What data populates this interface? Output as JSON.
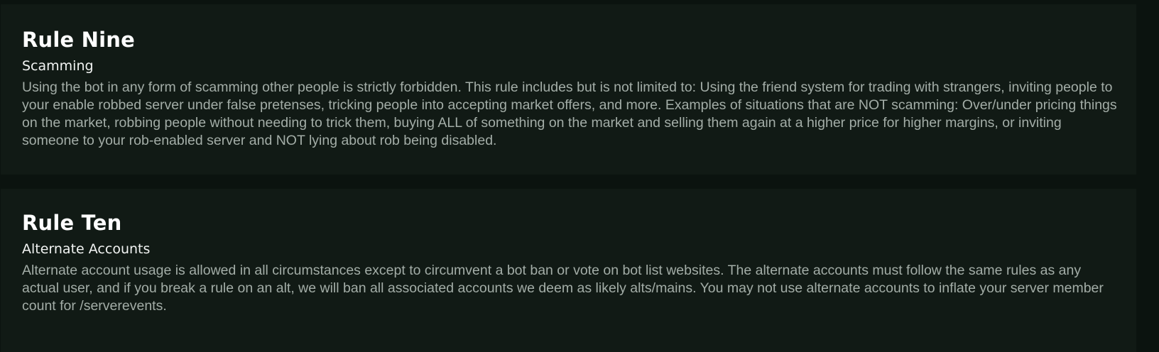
{
  "rules": [
    {
      "title": "Rule Nine",
      "subtitle": "Scamming",
      "body": "Using the bot in any form of scamming other people is strictly forbidden. This rule includes but is not limited to: Using the friend system for trading with strangers, inviting people to your enable robbed server under false pretenses, tricking people into accepting market offers, and more. Examples of situations that are NOT scamming: Over/under pricing things on the market, robbing people without needing to trick them, buying ALL of something on the market and selling them again at a higher price for higher margins, or inviting someone to your rob-enabled server and NOT lying about rob being disabled."
    },
    {
      "title": "Rule Ten",
      "subtitle": "Alternate Accounts",
      "body": "Alternate account usage is allowed in all circumstances except to circumvent a bot ban or vote on bot list websites. The alternate accounts must follow the same rules as any actual user, and if you break a rule on an alt, we will ban all associated accounts we deem as likely alts/mains. You may not use alternate accounts to inflate your server member count for /serverevents."
    }
  ],
  "colors": {
    "page_background": "#0b130f",
    "card_background": "#111a15",
    "title": "#ffffff",
    "subtitle": "#f2f4f3",
    "body_text": "#a3ada7"
  }
}
